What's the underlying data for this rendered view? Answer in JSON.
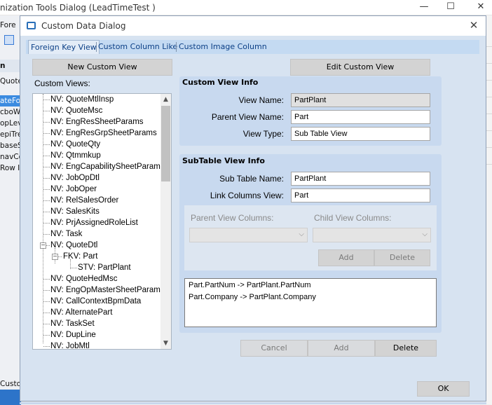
{
  "background_window": {
    "title": "nization Tools Dialog  (LeadTimeTest )",
    "menu_label": "Fore",
    "left_items": [
      "n",
      "Quote",
      "ateFor",
      "cboW",
      "opLev",
      "epiTre",
      "baseS",
      "navCo",
      "Row I"
    ],
    "bottom_left": "Custom",
    "controls": {
      "minimize": "—",
      "maximize": "☐",
      "close": "✕"
    }
  },
  "dialog": {
    "title": "Custom Data Dialog",
    "close": "✕",
    "tabs": [
      {
        "label": "Foreign Key View",
        "active": true
      },
      {
        "label": "Custom Column Like",
        "active": false
      },
      {
        "label": "Custom Image Column",
        "active": false
      }
    ],
    "new_view_button": "New Custom View",
    "edit_view_button": "Edit Custom View",
    "custom_views_label": "Custom Views:",
    "tree": [
      {
        "label": "NV: QuoteMtlInsp",
        "level": 0
      },
      {
        "label": "NV: QuoteMsc",
        "level": 0
      },
      {
        "label": "NV: EngResSheetParams",
        "level": 0
      },
      {
        "label": "NV: EngResGrpSheetParams",
        "level": 0
      },
      {
        "label": "NV: QuoteQty",
        "level": 0
      },
      {
        "label": "NV: Qtmmkup",
        "level": 0
      },
      {
        "label": "NV: EngCapabilitySheetParams",
        "level": 0
      },
      {
        "label": "NV: JobOpDtl",
        "level": 0
      },
      {
        "label": "NV: JobOper",
        "level": 0
      },
      {
        "label": "NV: RelSalesOrder",
        "level": 0
      },
      {
        "label": "NV: SalesKits",
        "level": 0
      },
      {
        "label": "NV: PrjAssignedRoleList",
        "level": 0
      },
      {
        "label": "NV: Task",
        "level": 0
      },
      {
        "label": "NV: QuoteDtl",
        "level": 0,
        "expanded": true
      },
      {
        "label": "FKV: Part",
        "level": 1,
        "expanded": true
      },
      {
        "label": "STV: PartPlant",
        "level": 2
      },
      {
        "label": "NV: QuoteHedMsc",
        "level": 0
      },
      {
        "label": "NV: EngOpMasterSheetParams",
        "level": 0
      },
      {
        "label": "NV: CallContextBpmData",
        "level": 0
      },
      {
        "label": "NV: AlternatePart",
        "level": 0
      },
      {
        "label": "NV: TaskSet",
        "level": 0
      },
      {
        "label": "NV: DupLine",
        "level": 0
      },
      {
        "label": "NV: JobMtl",
        "level": 0
      }
    ],
    "scroll_up": "▲",
    "scroll_down": "▼",
    "custom_view_info": {
      "heading": "Custom View Info",
      "view_name_label": "View Name:",
      "view_name": "PartPlant",
      "parent_view_name_label": "Parent View Name:",
      "parent_view_name": "Part",
      "view_type_label": "View Type:",
      "view_type": "Sub Table View"
    },
    "subtable_view_info": {
      "heading": "SubTable View Info",
      "sub_table_name_label": "Sub Table Name:",
      "sub_table_name": "PartPlant",
      "link_columns_view_label": "Link Columns View:",
      "link_columns_view": "Part",
      "parent_view_columns_label": "Parent View Columns:",
      "child_view_columns_label": "Child View Columns:",
      "add_button": "Add",
      "delete_button": "Delete",
      "mappings": [
        "Part.PartNum -> PartPlant.PartNum",
        "Part.Company -> PartPlant.Company"
      ]
    },
    "cancel_button": "Cancel",
    "add_button": "Add",
    "delete_button": "Delete",
    "ok_button": "OK"
  }
}
